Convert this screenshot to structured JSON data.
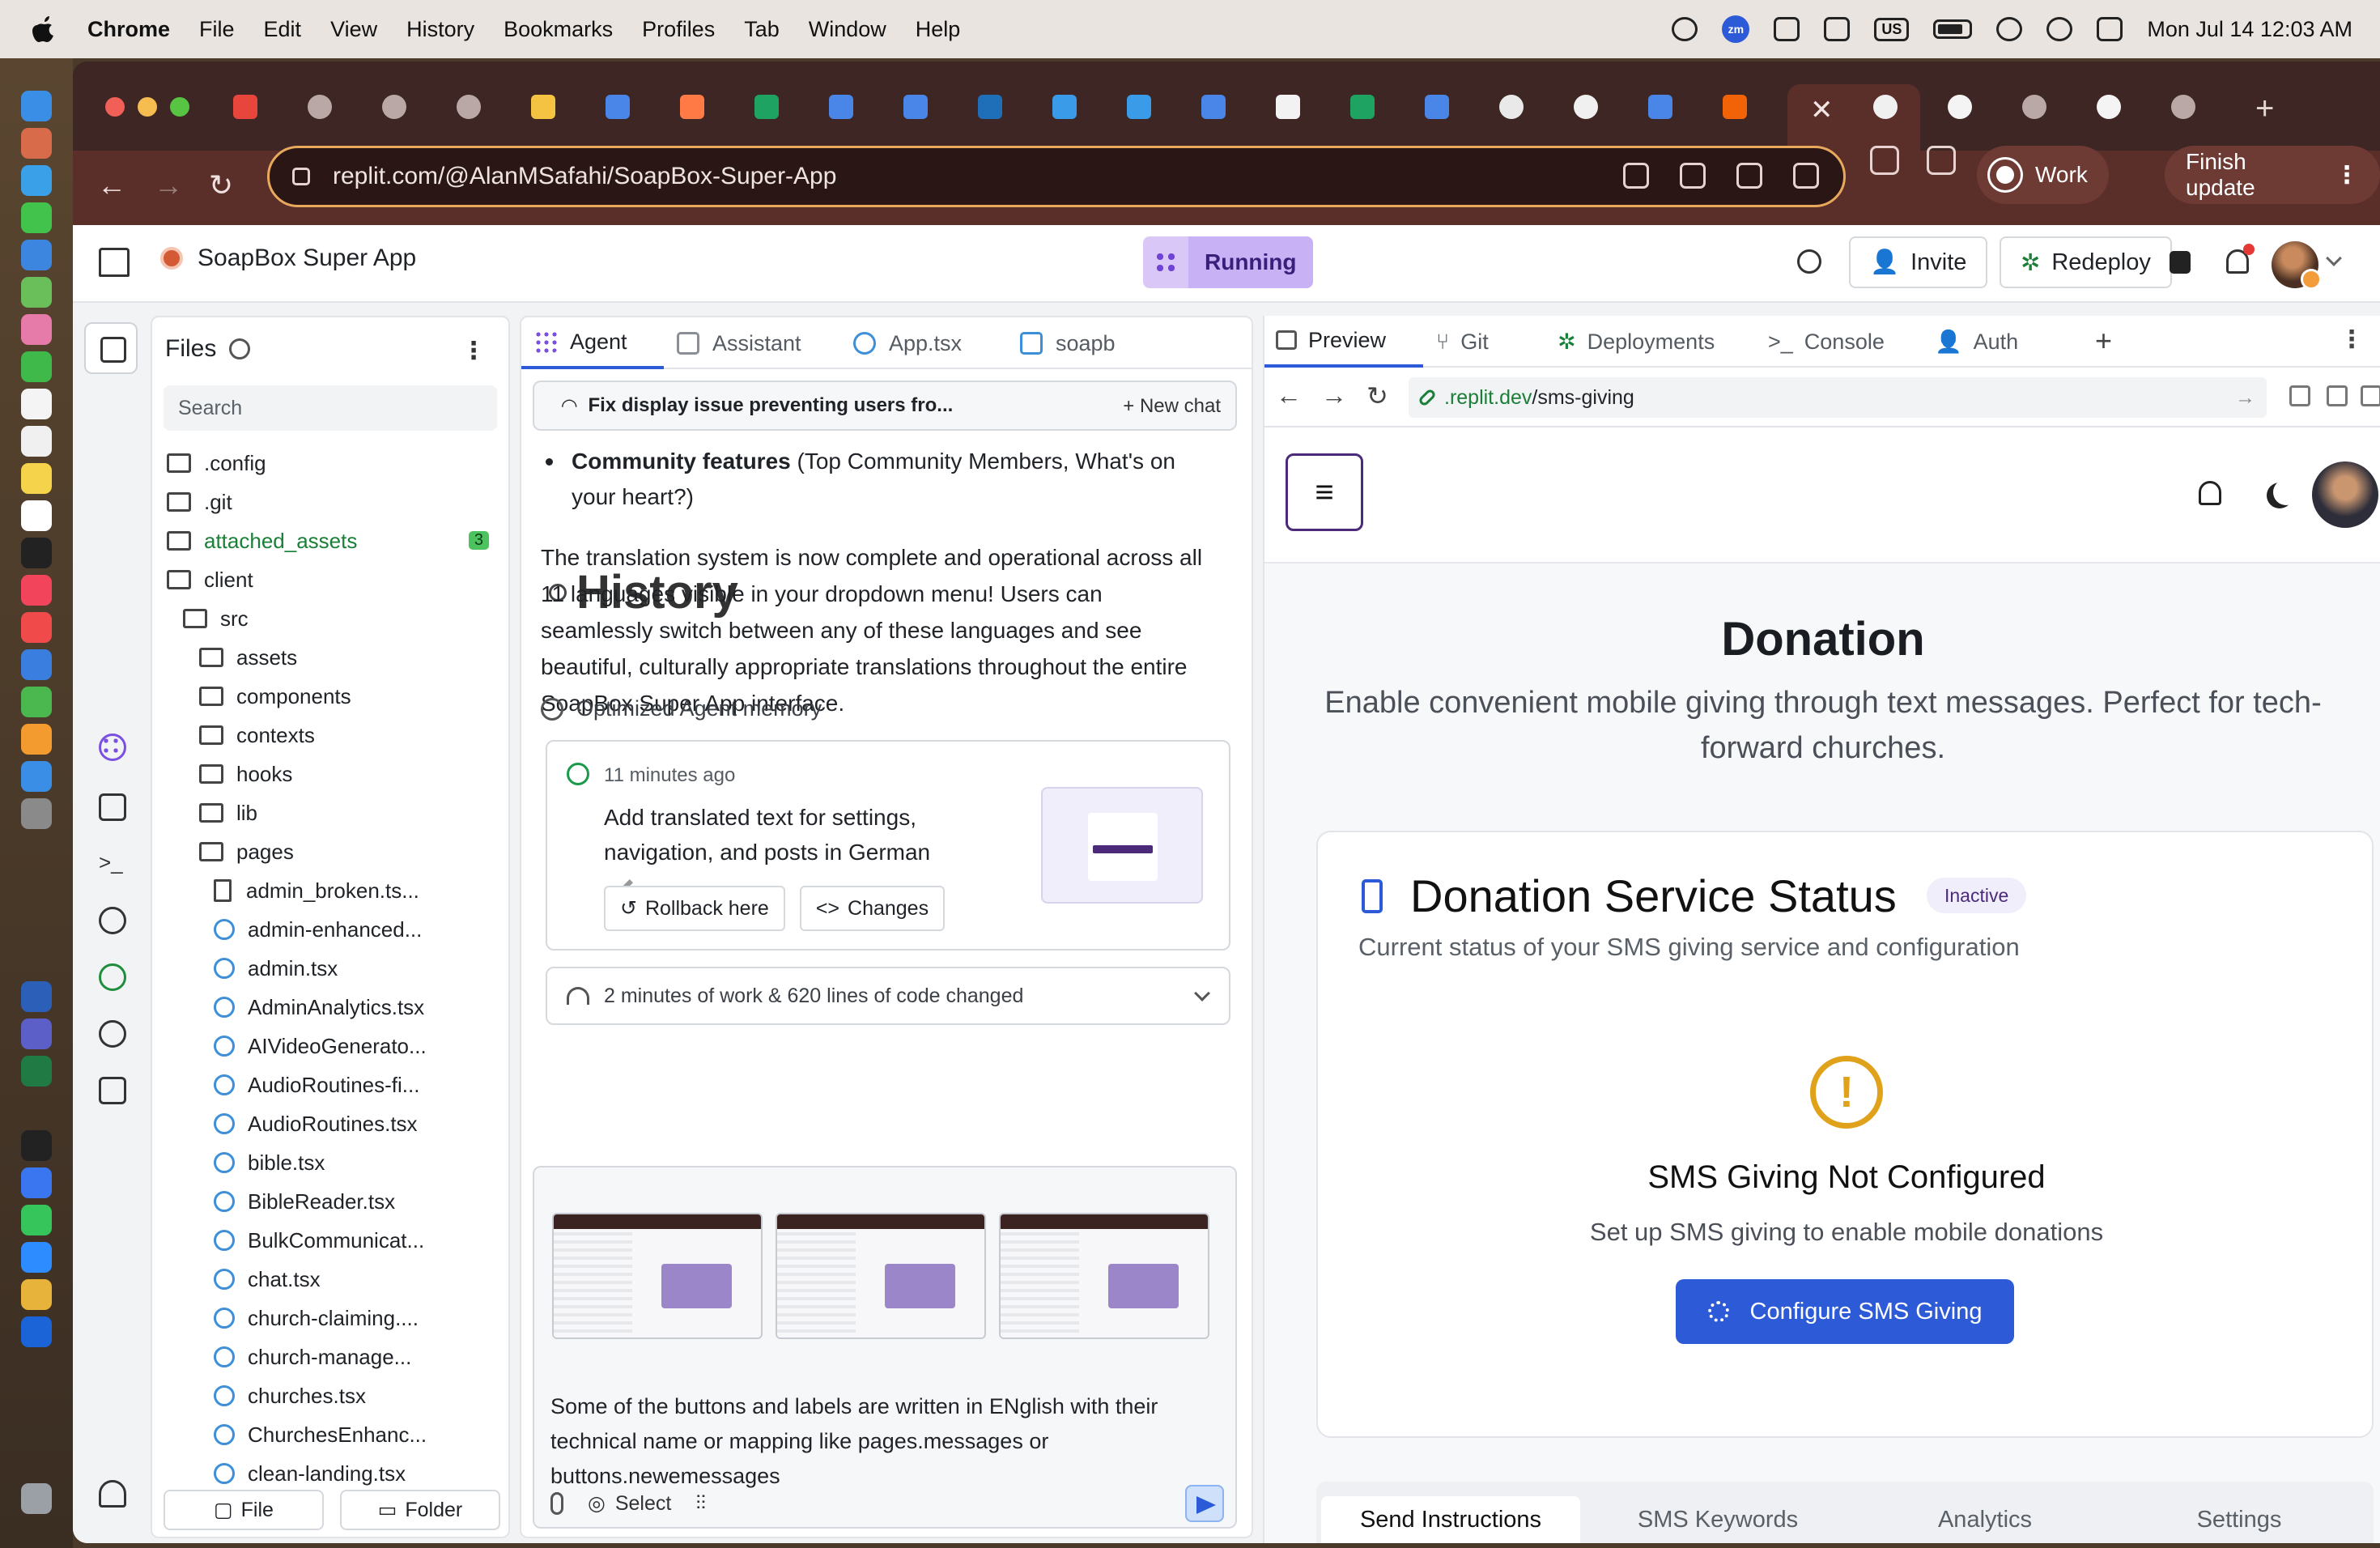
{
  "menubar": {
    "app_name": "Chrome",
    "items": [
      "File",
      "Edit",
      "View",
      "History",
      "Bookmarks",
      "Profiles",
      "Tab",
      "Window",
      "Help"
    ],
    "zoom_label": "zm",
    "input_source": "US",
    "datetime": "Mon Jul 14  12:03 AM"
  },
  "browser": {
    "url": "replit.com/@AlanMSafahi/SoapBox-Super-App",
    "profile_label": "Work",
    "update_label": "Finish update"
  },
  "replit": {
    "project_name": "SoapBox Super App",
    "status_label": "Running",
    "invite_label": "Invite",
    "redeploy_label": "Redeploy"
  },
  "files": {
    "title": "Files",
    "search_placeholder": "Search",
    "tree": [
      {
        "name": ".config",
        "type": "folder",
        "depth": 0
      },
      {
        "name": ".git",
        "type": "folder",
        "depth": 0
      },
      {
        "name": "attached_assets",
        "type": "folder",
        "depth": 0,
        "badge": "3",
        "highlight": true
      },
      {
        "name": "client",
        "type": "folder",
        "depth": 0
      },
      {
        "name": "src",
        "type": "folder",
        "depth": 1
      },
      {
        "name": "assets",
        "type": "folder",
        "depth": 2
      },
      {
        "name": "components",
        "type": "folder",
        "depth": 2
      },
      {
        "name": "contexts",
        "type": "folder",
        "depth": 2
      },
      {
        "name": "hooks",
        "type": "folder",
        "depth": 2
      },
      {
        "name": "lib",
        "type": "folder",
        "depth": 2
      },
      {
        "name": "pages",
        "type": "folder",
        "depth": 2
      },
      {
        "name": "admin_broken.ts...",
        "type": "file",
        "depth": 3
      },
      {
        "name": "admin-enhanced...",
        "type": "react",
        "depth": 3
      },
      {
        "name": "admin.tsx",
        "type": "react",
        "depth": 3
      },
      {
        "name": "AdminAnalytics.tsx",
        "type": "react",
        "depth": 3
      },
      {
        "name": "AIVideoGenerato...",
        "type": "react",
        "depth": 3
      },
      {
        "name": "AudioRoutines-fi...",
        "type": "react",
        "depth": 3
      },
      {
        "name": "AudioRoutines.tsx",
        "type": "react",
        "depth": 3
      },
      {
        "name": "bible.tsx",
        "type": "react",
        "depth": 3
      },
      {
        "name": "BibleReader.tsx",
        "type": "react",
        "depth": 3
      },
      {
        "name": "BulkCommunicat...",
        "type": "react",
        "depth": 3
      },
      {
        "name": "chat.tsx",
        "type": "react",
        "depth": 3
      },
      {
        "name": "church-claiming....",
        "type": "react",
        "depth": 3
      },
      {
        "name": "church-manage...",
        "type": "react",
        "depth": 3
      },
      {
        "name": "churches.tsx",
        "type": "react",
        "depth": 3
      },
      {
        "name": "ChurchesEnhanc...",
        "type": "react",
        "depth": 3
      },
      {
        "name": "clean-landing.tsx",
        "type": "react",
        "depth": 3
      }
    ],
    "new_file_label": "File",
    "new_folder_label": "Folder"
  },
  "agent": {
    "tabs": [
      "Agent",
      "Assistant",
      "App.tsx",
      "soapb"
    ],
    "history_label": "History",
    "chat_title": "Fix display issue preventing users fro...",
    "new_chat_label": "+ New chat",
    "bullet_bold": "Community features",
    "bullet_rest": " (Top Community Members, What's on your heart?)",
    "paragraph": "The translation system is now complete and operational across all 11 languages visible in your dropdown menu! Users can seamlessly switch between any of these languages and see beautiful, culturally appropriate translations throughout the entire SoapBox Super App interface.",
    "memory_label": "Optimized Agent memory",
    "checkpoint": {
      "time": "11 minutes ago",
      "message": "Add translated text for settings, navigation, and posts in German",
      "rollback_label": "Rollback here",
      "changes_label": "Changes"
    },
    "work_summary": "2 minutes of work & 620 lines of code changed",
    "composer_text": "Some of the buttons and labels are written in ENglish with their technical name or mapping like pages.messages or buttons.newemessages",
    "select_label": "Select"
  },
  "preview": {
    "tabs": [
      "Preview",
      "Git",
      "Deployments",
      "Console",
      "Auth"
    ],
    "url_domain": ".replit.dev",
    "url_path": "/sms-giving",
    "site": {
      "heading": "Donation",
      "subheading": "Enable convenient mobile giving through text messages. Perfect for tech-forward churches.",
      "card_title": "Donation Service Status",
      "status_badge": "Inactive",
      "card_desc": "Current status of your SMS giving service and configuration",
      "warn_symbol": "!",
      "not_configured": "SMS Giving Not Configured",
      "setup_text": "Set up SMS giving to enable mobile donations",
      "configure_label": "Configure SMS Giving",
      "subtabs": [
        "Send Instructions",
        "SMS Keywords",
        "Analytics",
        "Settings"
      ]
    }
  },
  "colors": {
    "accent_blue": "#2d5bd7",
    "running_purple": "#c8b2f5",
    "warning": "#e0a21b",
    "success_green": "#1a7f37"
  }
}
